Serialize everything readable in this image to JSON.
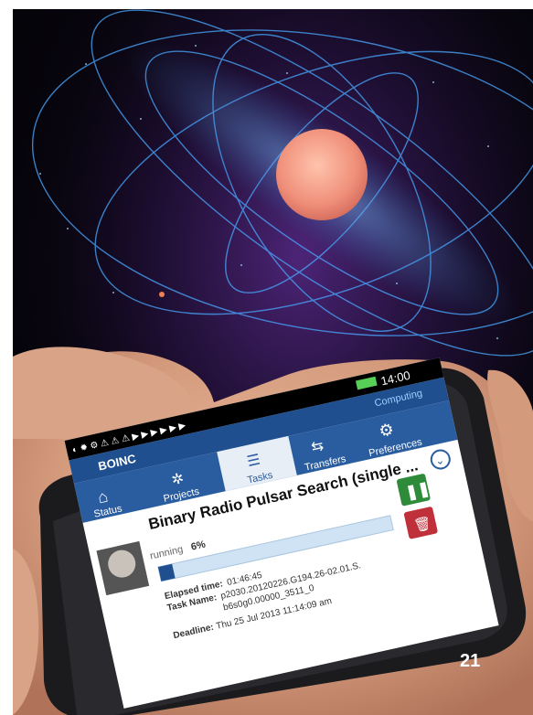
{
  "status_bar": {
    "time": "14:00",
    "computing_label": "Computing"
  },
  "app": {
    "name": "BOINC"
  },
  "nav": {
    "tabs": [
      {
        "id": "status",
        "label": "Status"
      },
      {
        "id": "projects",
        "label": "Projects"
      },
      {
        "id": "tasks",
        "label": "Tasks"
      },
      {
        "id": "transfers",
        "label": "Transfers"
      },
      {
        "id": "preferences",
        "label": "Preferences"
      }
    ],
    "active_tab": "Tasks"
  },
  "task": {
    "title": "Binary Radio Pulsar Search (single ...",
    "status": "running",
    "percent": "6%",
    "progress_fraction": 0.06,
    "elapsed_label": "Elapsed time:",
    "elapsed_value": "01:46:45",
    "task_name_label": "Task Name:",
    "task_name_line1": "p2030.20120226.G194.26-02.01.S.",
    "task_name_line2": "b6s0g0.00000_3511_0",
    "deadline_label": "Deadline:",
    "deadline_value": "Thu 25 Jul 2013 11:14:09 am"
  },
  "page_number": "21",
  "colors": {
    "boinc_blue": "#1f4f8f",
    "tab_bar": "#2a5da0",
    "pause_green": "#2e8b3a",
    "delete_red": "#c0303a",
    "progress_fill": "#1f4f8f",
    "progress_track": "#cfe3f5",
    "star": "#f4a08a",
    "field_lines": "#49a8ff"
  }
}
